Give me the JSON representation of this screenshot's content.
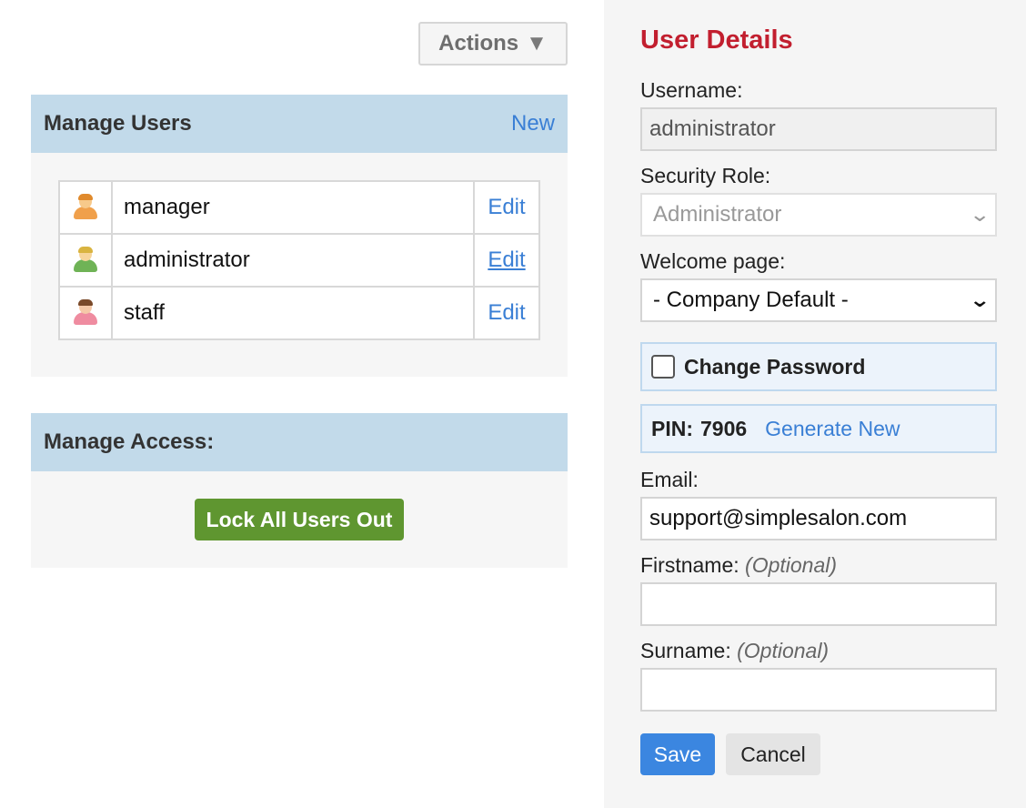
{
  "actions": {
    "label": "Actions",
    "caret": "▼"
  },
  "manage_users": {
    "title": "Manage Users",
    "new_label": "New",
    "users": [
      {
        "name": "manager",
        "edit_label": "Edit",
        "avatar_color": "#f0a04b"
      },
      {
        "name": "administrator",
        "edit_label": "Edit",
        "avatar_color": "#6fb356"
      },
      {
        "name": "staff",
        "edit_label": "Edit",
        "avatar_color": "#ef8ca0"
      }
    ]
  },
  "manage_access": {
    "title": "Manage Access:",
    "lock_button": "Lock All Users Out"
  },
  "user_details": {
    "title": "User Details",
    "username_label": "Username:",
    "username_value": "administrator",
    "security_role_label": "Security Role:",
    "security_role_value": "Administrator",
    "welcome_page_label": "Welcome page:",
    "welcome_page_value": "- Company Default -",
    "change_password_label": "Change Password",
    "pin_label": "PIN:",
    "pin_value": "7906",
    "generate_new_label": "Generate New",
    "email_label": "Email:",
    "email_value": "support@simplesalon.com",
    "firstname_label": "Firstname:",
    "surname_label": "Surname:",
    "optional_label": "(Optional)",
    "save_label": "Save",
    "cancel_label": "Cancel"
  },
  "colors": {
    "accent_red": "#c21f2f",
    "link_blue": "#3a7fd5",
    "header_blue": "#c2daea",
    "lock_green": "#5f9630",
    "save_blue": "#3b86e0"
  }
}
